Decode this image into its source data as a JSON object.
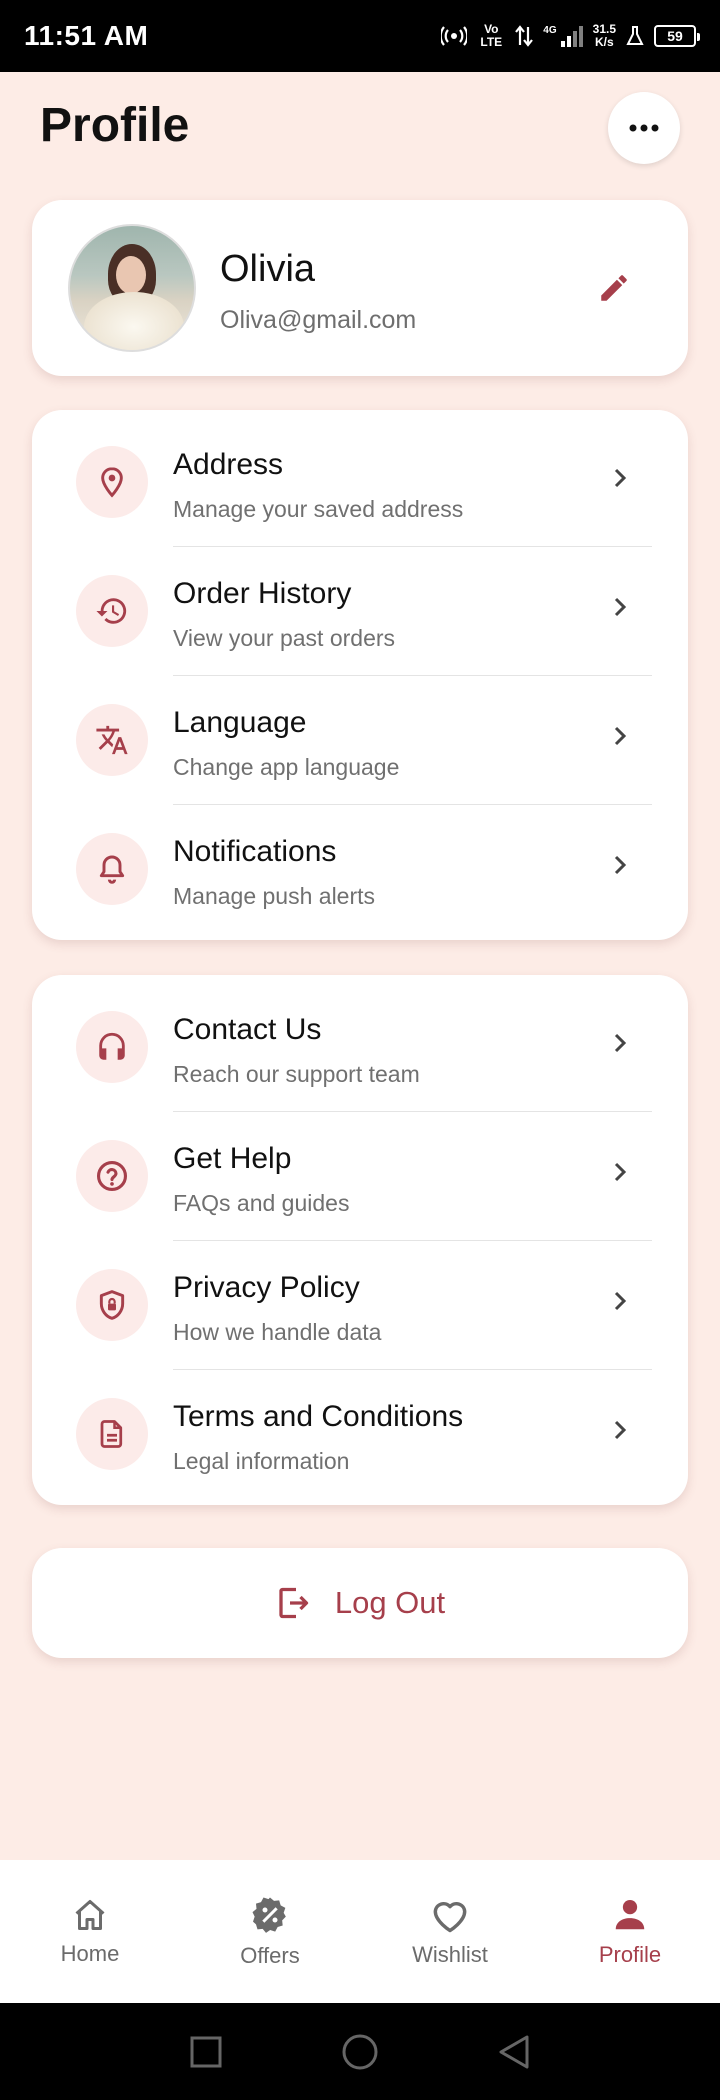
{
  "status_bar": {
    "time": "11:51 AM",
    "network": "4G",
    "volte": "Vo LTE",
    "speed_value": "31.5",
    "speed_unit": "K/s",
    "battery": "59"
  },
  "header": {
    "title": "Profile",
    "more_icon": "more-horizontal-icon"
  },
  "profile": {
    "name": "Olivia",
    "email": "Oliva@gmail.com",
    "edit_icon": "pencil-icon"
  },
  "menu_group_1": [
    {
      "title": "Address",
      "subtitle": "Manage your saved address",
      "icon": "location-pin-icon"
    },
    {
      "title": "Order History",
      "subtitle": "View your past orders",
      "icon": "history-icon"
    },
    {
      "title": "Language",
      "subtitle": "Change app language",
      "icon": "translate-icon"
    },
    {
      "title": "Notifications",
      "subtitle": "Manage push alerts",
      "icon": "bell-icon"
    }
  ],
  "menu_group_2": [
    {
      "title": "Contact Us",
      "subtitle": "Reach our support team",
      "icon": "headset-icon"
    },
    {
      "title": "Get Help",
      "subtitle": "FAQs and guides",
      "icon": "help-circle-icon"
    },
    {
      "title": "Privacy Policy",
      "subtitle": "How we handle data",
      "icon": "shield-lock-icon"
    },
    {
      "title": "Terms and Conditions",
      "subtitle": "Legal information",
      "icon": "document-icon"
    }
  ],
  "logout": {
    "label": "Log Out",
    "icon": "logout-icon"
  },
  "bottom_nav": [
    {
      "label": "Home",
      "icon": "home-icon",
      "active": false
    },
    {
      "label": "Offers",
      "icon": "discount-badge-icon",
      "active": false
    },
    {
      "label": "Wishlist",
      "icon": "heart-icon",
      "active": false
    },
    {
      "label": "Profile",
      "icon": "person-icon",
      "active": true
    }
  ],
  "colors": {
    "accent": "#a63f4b",
    "background": "#fdece6",
    "icon_bg": "#fcebe9",
    "inactive": "#6b6b6b"
  }
}
